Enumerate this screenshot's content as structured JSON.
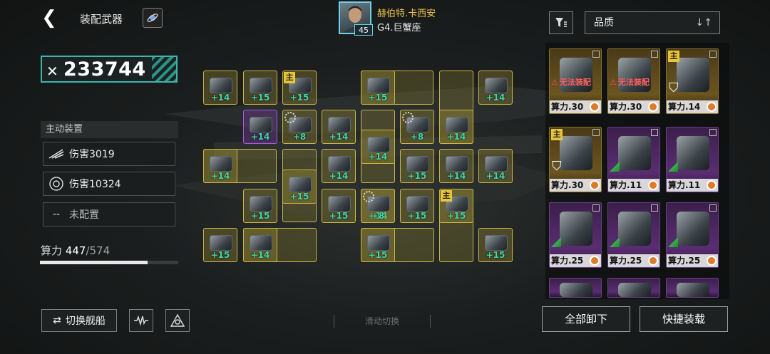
{
  "header": {
    "title": "装配武器",
    "player_name": "赫伯特.卡西安",
    "player_ship": "G4.巨蟹座",
    "player_level": "45"
  },
  "power": {
    "value": "233744"
  },
  "active": {
    "header": "主动装置",
    "rows": [
      {
        "icon": "missile-wing-icon",
        "label": "伤害3019"
      },
      {
        "icon": "ring-core-icon",
        "label": "伤害10324"
      },
      {
        "icon": "dash-icon",
        "prefix": "--",
        "label": "未配置"
      }
    ]
  },
  "calc": {
    "label": "算力",
    "used": "447",
    "max": "/574",
    "fill_fraction": 0.779
  },
  "buttons": {
    "swap": "切换舰船",
    "unload_all": "全部卸下",
    "quick_equip": "快捷装载"
  },
  "slide_hint": "滑动切换",
  "sort": {
    "label": "品质"
  },
  "slots": [
    {
      "lv": "+14"
    },
    {
      "lv": "+15"
    },
    {
      "lv": "+15",
      "main": "主"
    },
    {
      "lv": "+15"
    },
    {
      "lv": "+14"
    },
    {
      "lv": "+14"
    },
    {
      "lv": "+8"
    },
    {
      "lv": "+14"
    },
    {
      "lv": "+8"
    },
    {
      "lv": "+14"
    },
    {
      "lv": "+14"
    },
    {
      "lv": "+14"
    },
    {
      "lv": "+15"
    },
    {
      "lv": "+14"
    },
    {
      "lv": "+14"
    },
    {
      "lv": "+15"
    },
    {
      "lv": "+14"
    },
    {
      "lv": "+15"
    },
    {
      "lv": "+15"
    },
    {
      "lv": "+14"
    },
    {
      "lv": "+8"
    },
    {
      "lv": "+15"
    },
    {
      "lv": "+15",
      "main": "主"
    },
    {
      "lv": "+15"
    },
    {
      "lv": "+14"
    },
    {
      "lv": "+15"
    },
    {
      "lv": "+15"
    }
  ],
  "inventory": [
    {
      "quality": "gold",
      "calc": "算力.30",
      "warning": "无法装配"
    },
    {
      "quality": "gold",
      "calc": "算力.30",
      "warning": "无法装配"
    },
    {
      "quality": "gold",
      "calc": "算力.14",
      "main": "主"
    },
    {
      "quality": "gold",
      "calc": "算力.30",
      "main": "主"
    },
    {
      "quality": "purp",
      "calc": "算力.11"
    },
    {
      "quality": "purp",
      "calc": "算力.11"
    },
    {
      "quality": "purp",
      "calc": "算力.25"
    },
    {
      "quality": "purp",
      "calc": "算力.25"
    },
    {
      "quality": "purp",
      "calc": "算力.25"
    }
  ],
  "colors": {
    "accent_teal": "#3fb5a8",
    "slot_gold": "#c9b646",
    "level_green": "#3fd6b0",
    "warning_red": "#ff5f5f"
  }
}
